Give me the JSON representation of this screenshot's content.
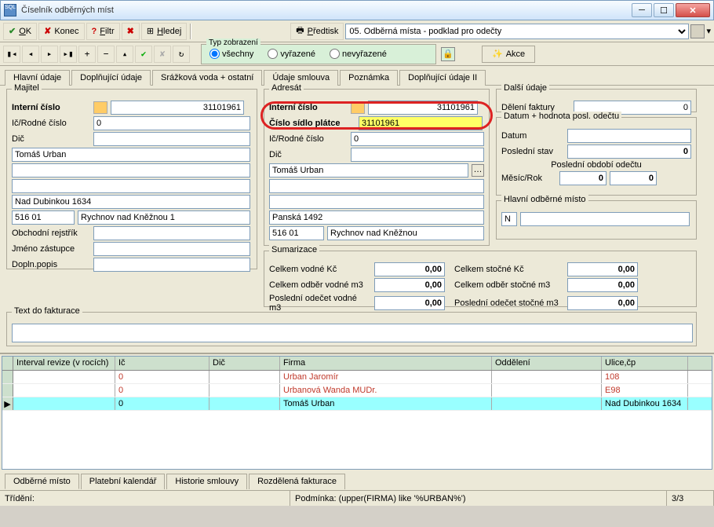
{
  "window": {
    "title": "Číselník odběrných míst"
  },
  "toolbar": {
    "ok": "OK",
    "konec": "Konec",
    "filtr": "Filtr",
    "hledej": "Hledej",
    "predtisk": "Předtisk",
    "predtisk_sel": "05. Odběrná místa - podklad pro odečty"
  },
  "typzobr": {
    "legend": "Typ zobrazení",
    "r1": "všechny",
    "r2": "vyřazené",
    "r3": "nevyřazené"
  },
  "akce": "Akce",
  "tabs": [
    "Hlavní údaje",
    "Doplňující údaje",
    "Srážková voda + ostatní",
    "Údaje smlouva",
    "Poznámka",
    "Doplňující údaje II"
  ],
  "majitel": {
    "legend": "Majitel",
    "intc_lbl": "Interní číslo",
    "intc": "31101961",
    "icrc_lbl": "Ič/Rodné číslo",
    "icrc": "0",
    "dic_lbl": "Dič",
    "name": "Tomáš Urban",
    "street": "Nad Dubinkou 1634",
    "zip": "516 01",
    "city": "Rychnov nad Kněžnou 1",
    "or_lbl": "Obchodní rejstřík",
    "jz_lbl": "Jméno zástupce",
    "dp_lbl": "Dopln.popis"
  },
  "adresat": {
    "legend": "Adresát",
    "intc_lbl": "Interní číslo",
    "intc": "31101961",
    "csp_lbl": "Číslo sídlo plátce",
    "csp": "31101961",
    "icrc_lbl": "Ič/Rodné číslo",
    "icrc": "0",
    "dic_lbl": "Dič",
    "name": "Tomáš Urban",
    "street": "Panská 1492",
    "zip": "516 01",
    "city": "Rychnov nad Kněžnou"
  },
  "sumarizace": {
    "legend": "Sumarizace",
    "cvk_lbl": "Celkem vodné Kč",
    "cvk": "0,00",
    "covm_lbl": "Celkem odběr vodné m3",
    "covm": "0,00",
    "pov_lbl": "Poslední odečet vodné m3",
    "pov": "0,00",
    "csk_lbl": "Celkem stočné Kč",
    "csk": "0,00",
    "cosm_lbl": "Celkem odběr stočné m3",
    "cosm": "0,00",
    "pos_lbl": "Poslední odečet stočné m3",
    "pos": "0,00"
  },
  "dalsi": {
    "legend": "Další údaje",
    "df_lbl": "Dělení faktury",
    "df": "0",
    "dh_legend": "Datum + hodnota posl. odečtu",
    "datum_lbl": "Datum",
    "ps_lbl": "Poslední stav",
    "ps": "0",
    "poo_lbl": "Poslední období odečtu",
    "mr_lbl": "Měsíc/Rok",
    "mr1": "0",
    "mr2": "0",
    "hom_legend": "Hlavní odběrné místo",
    "hom": "N"
  },
  "textdf": {
    "legend": "Text do fakturace"
  },
  "grid": {
    "headers": [
      "Interval revize (v rocích)",
      "Ič",
      "Dič",
      "Firma",
      "Oddělení",
      "Ulice,čp"
    ],
    "rows": [
      {
        "ir": "",
        "ic": "0",
        "dic": "",
        "firma": "Urban Jaromír",
        "odd": "",
        "ulice": "108"
      },
      {
        "ir": "",
        "ic": "0",
        "dic": "",
        "firma": "Urbanová Wanda MUDr.",
        "odd": "",
        "ulice": "E98"
      },
      {
        "ir": "",
        "ic": "0",
        "dic": "",
        "firma": "Tomáš Urban",
        "odd": "",
        "ulice": "Nad Dubinkou 1634"
      }
    ]
  },
  "bottabs": [
    "Odběrné místo",
    "Platební kalendář",
    "Historie smlouvy",
    "Rozdělená fakturace"
  ],
  "status": {
    "tr": "Třídění:",
    "pod": "Podmínka: (upper(FIRMA) like '%URBAN%')",
    "cnt": "3/3"
  }
}
